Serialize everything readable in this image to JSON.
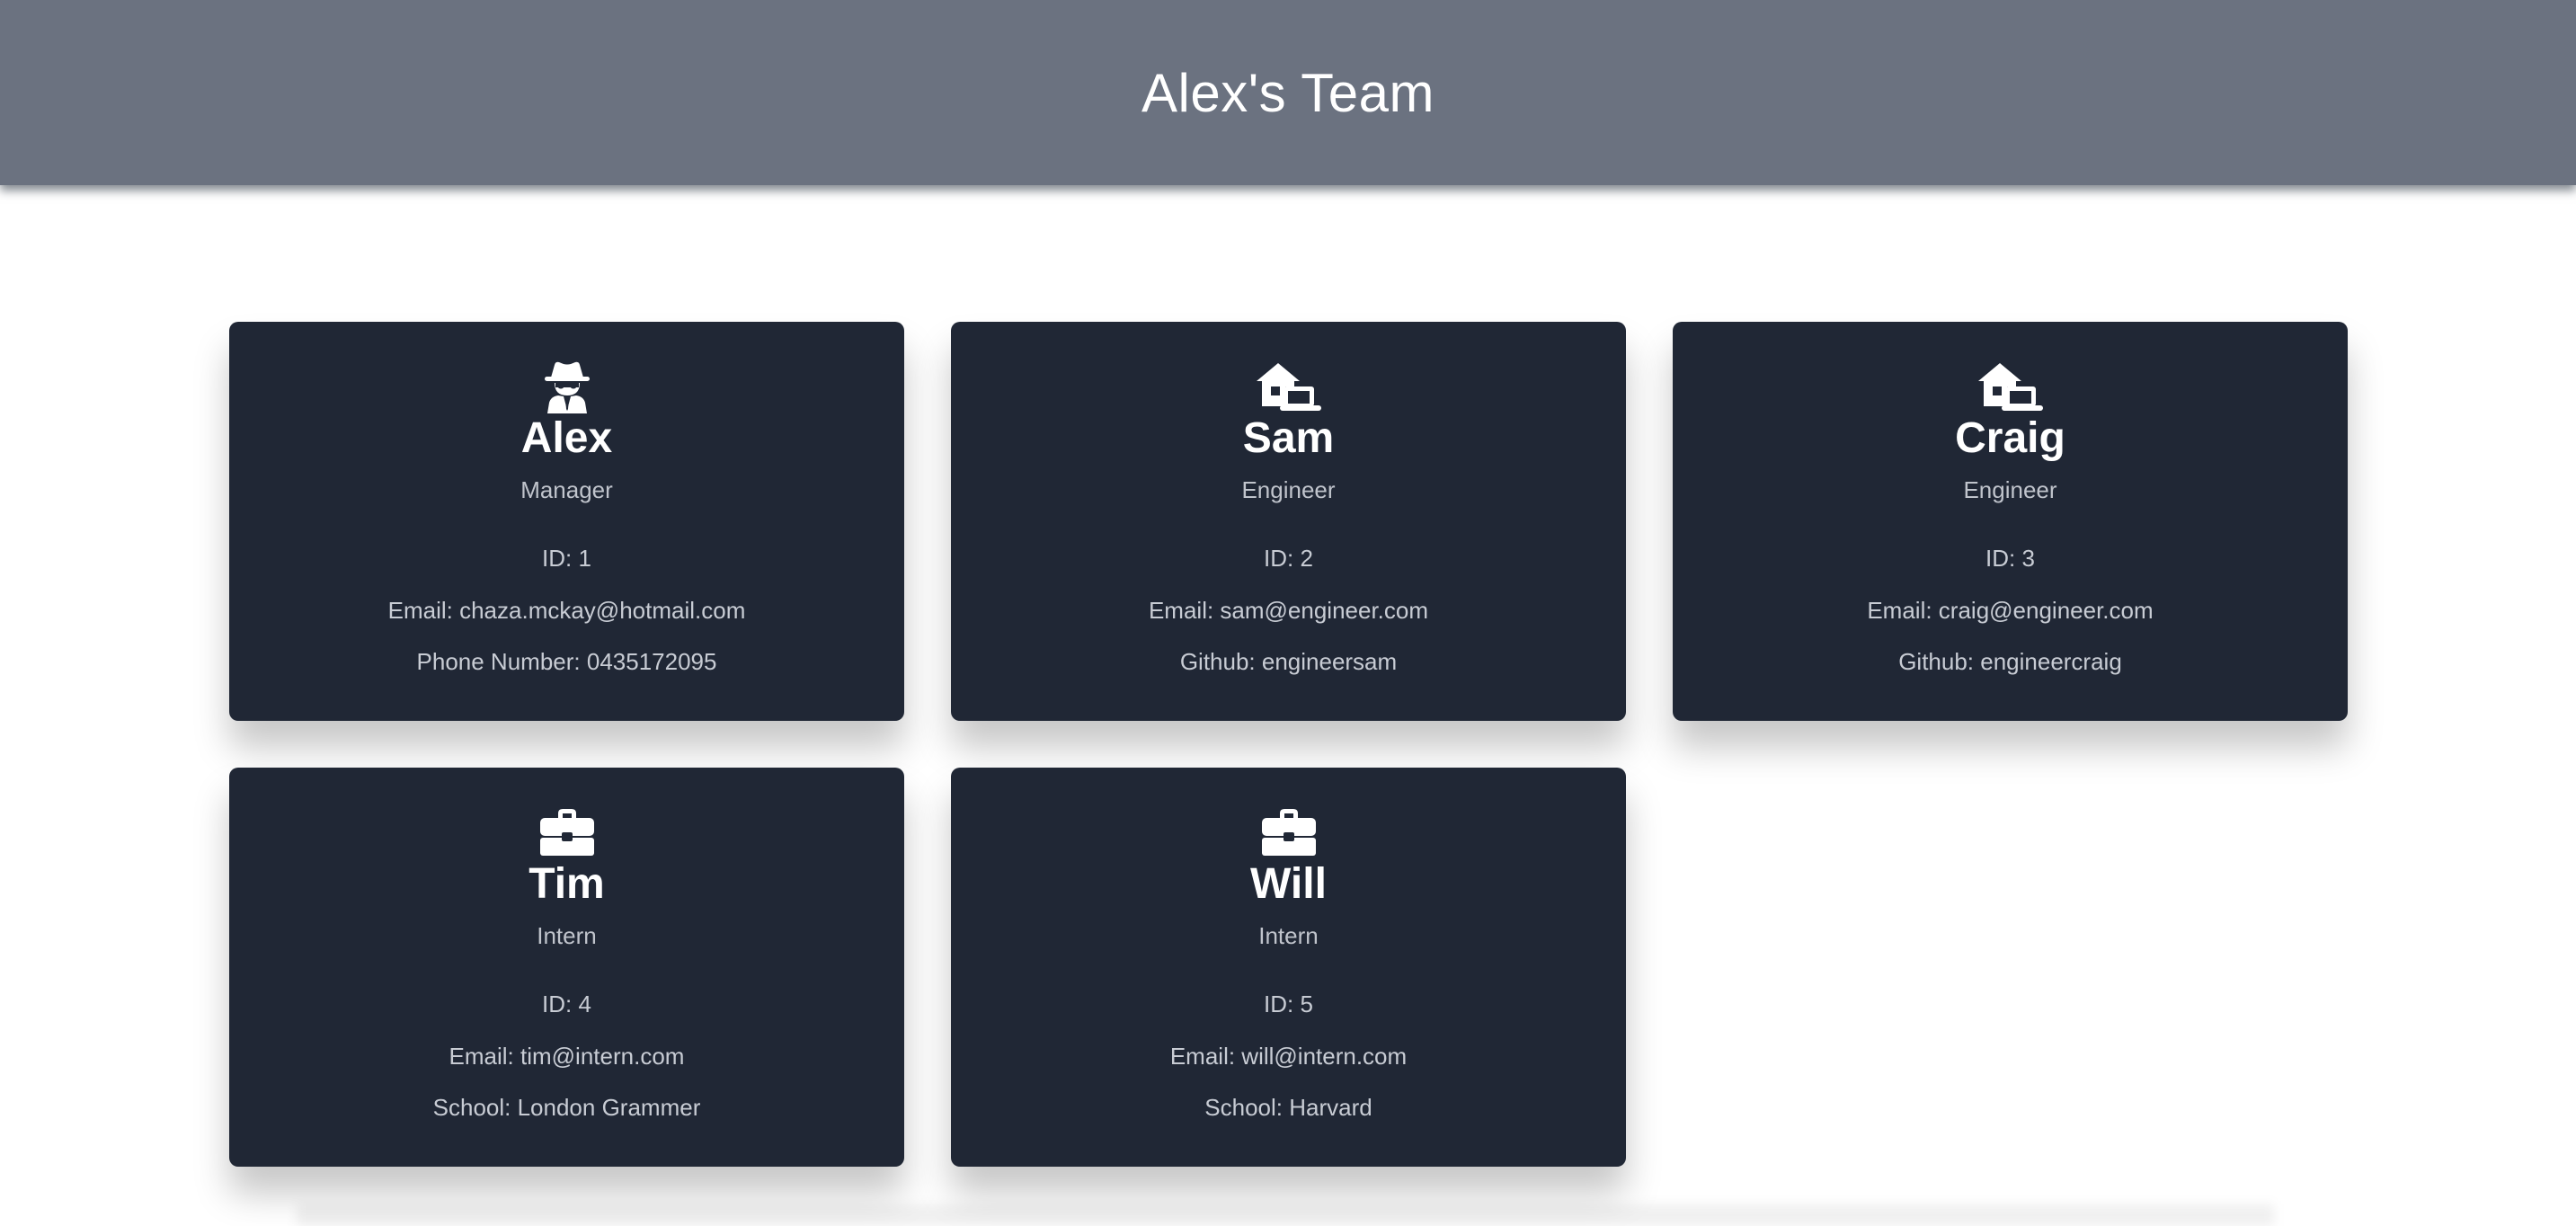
{
  "header": {
    "title": "Alex's Team"
  },
  "members": [
    {
      "name": "Alex",
      "role": "Manager",
      "id": "ID: 1",
      "email": "Email: chaza.mckay@hotmail.com",
      "extra": "Phone Number: 0435172095",
      "icon": "spy-icon"
    },
    {
      "name": "Sam",
      "role": "Engineer",
      "id": "ID: 2",
      "email": "Email: sam@engineer.com",
      "extra": "Github: engineersam",
      "icon": "house-laptop-icon"
    },
    {
      "name": "Craig",
      "role": "Engineer",
      "id": "ID: 3",
      "email": "Email: craig@engineer.com",
      "extra": "Github: engineercraig",
      "icon": "house-laptop-icon"
    },
    {
      "name": "Tim",
      "role": "Intern",
      "id": "ID: 4",
      "email": "Email: tim@intern.com",
      "extra": "School: London Grammer",
      "icon": "briefcase-icon"
    },
    {
      "name": "Will",
      "role": "Intern",
      "id": "ID: 5",
      "email": "Email: will@intern.com",
      "extra": "School: Harvard",
      "icon": "briefcase-icon"
    }
  ],
  "colors": {
    "header_bg": "#6b7280",
    "card_bg": "#202735",
    "text_light": "#c8ccd4",
    "title": "#ffffff"
  }
}
